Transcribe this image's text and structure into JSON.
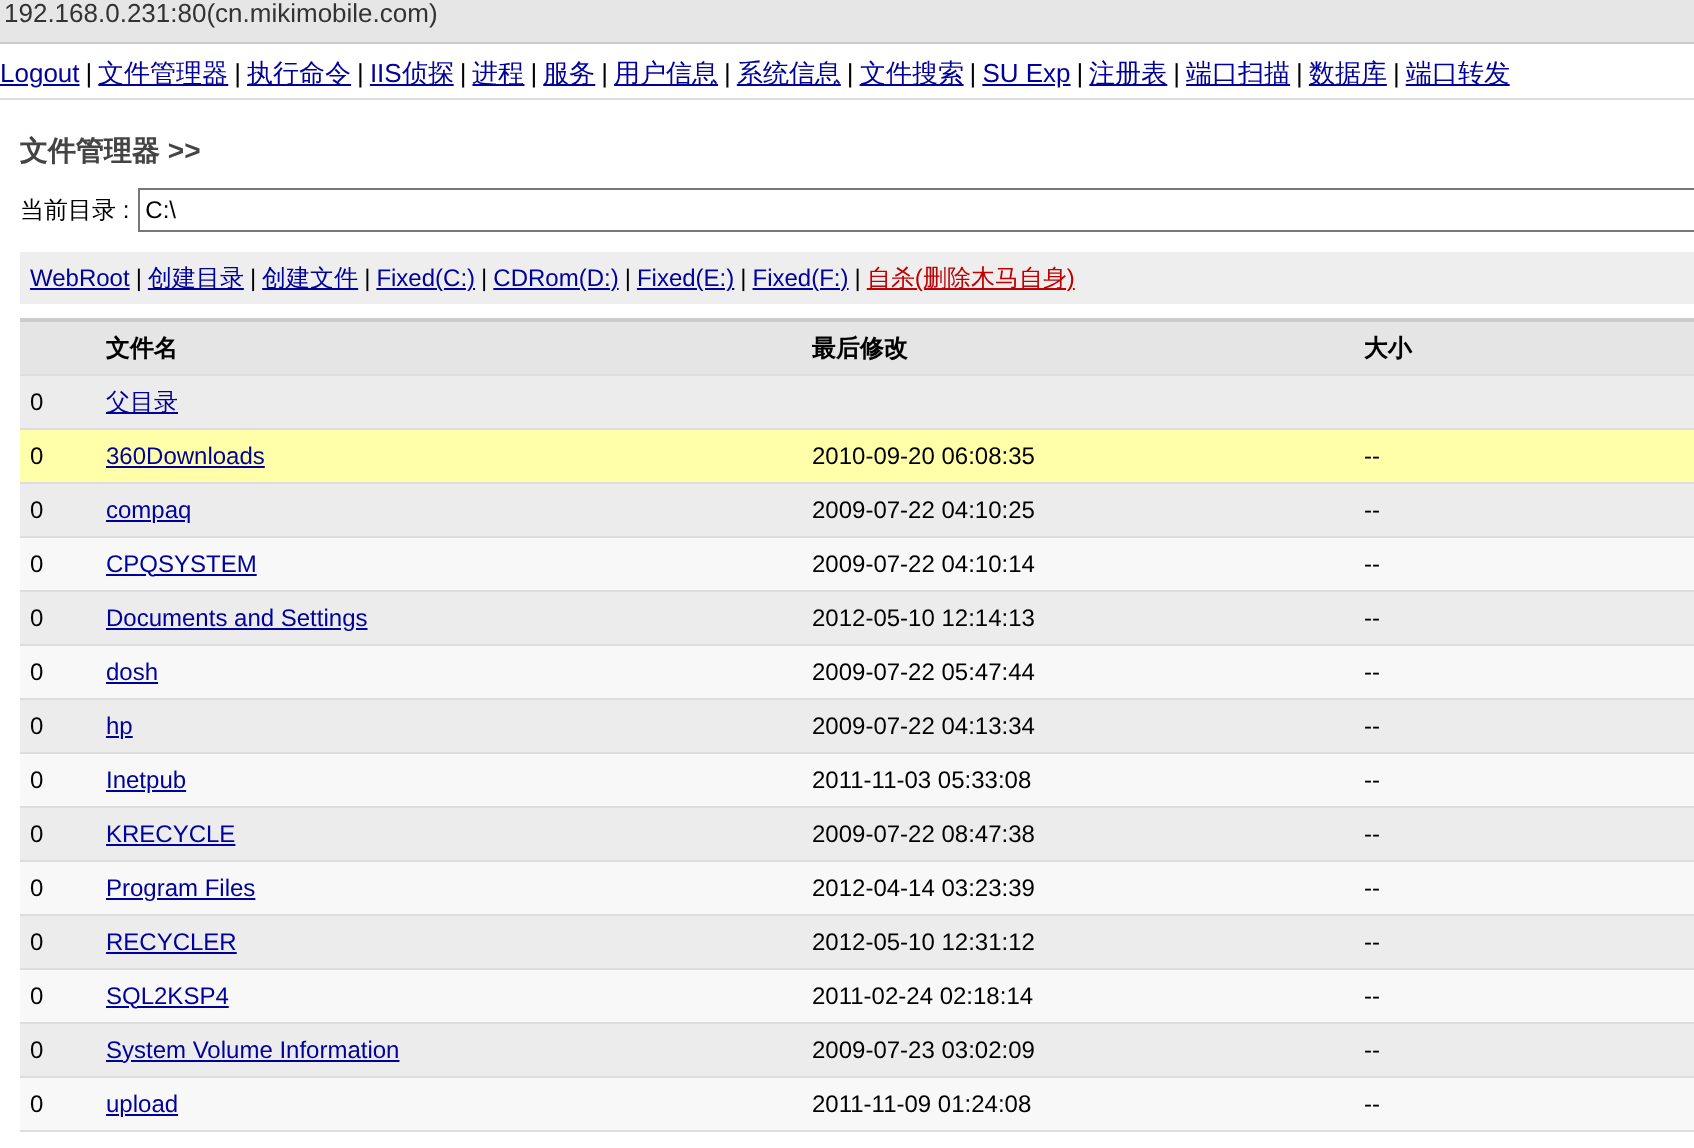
{
  "window": {
    "title": "192.168.0.231:80(cn.mikimobile.com)"
  },
  "separator": "|",
  "nav": [
    "Logout",
    "文件管理器",
    "执行命令",
    "IIS侦探",
    "进程",
    "服务",
    "用户信息",
    "系统信息",
    "文件搜索",
    "SU Exp",
    "注册表",
    "端口扫描",
    "数据库",
    "端口转发"
  ],
  "heading": "文件管理器 >>",
  "current_dir": {
    "label": "当前目录 :",
    "value": "C:\\"
  },
  "toolbar": [
    {
      "label": "WebRoot",
      "kind": "normal"
    },
    {
      "label": "创建目录",
      "kind": "normal"
    },
    {
      "label": "创建文件",
      "kind": "normal"
    },
    {
      "label": "Fixed(C:)",
      "kind": "normal"
    },
    {
      "label": "CDRom(D:)",
      "kind": "normal"
    },
    {
      "label": "Fixed(E:)",
      "kind": "normal"
    },
    {
      "label": "Fixed(F:)",
      "kind": "normal"
    },
    {
      "label": "自杀(删除木马自身)",
      "kind": "danger"
    }
  ],
  "table": {
    "columns": [
      "文件名",
      "最后修改",
      "大小"
    ],
    "rows": [
      {
        "index": "0",
        "name": "父目录",
        "highlighted": false
      },
      {
        "index": "0",
        "name": "360Downloads",
        "modified": "2010-09-20 06:08:35",
        "size": "--",
        "highlighted": true
      },
      {
        "index": "0",
        "name": "compaq",
        "modified": "2009-07-22 04:10:25",
        "size": "--",
        "highlighted": false
      },
      {
        "index": "0",
        "name": "CPQSYSTEM",
        "modified": "2009-07-22 04:10:14",
        "size": "--",
        "highlighted": false
      },
      {
        "index": "0",
        "name": "Documents and Settings",
        "modified": "2012-05-10 12:14:13",
        "size": "--",
        "highlighted": false
      },
      {
        "index": "0",
        "name": "dosh",
        "modified": "2009-07-22 05:47:44",
        "size": "--",
        "highlighted": false
      },
      {
        "index": "0",
        "name": "hp",
        "modified": "2009-07-22 04:13:34",
        "size": "--",
        "highlighted": false
      },
      {
        "index": "0",
        "name": "Inetpub",
        "modified": "2011-11-03 05:33:08",
        "size": "--",
        "highlighted": false
      },
      {
        "index": "0",
        "name": "KRECYCLE",
        "modified": "2009-07-22 08:47:38",
        "size": "--",
        "highlighted": false
      },
      {
        "index": "0",
        "name": "Program Files",
        "modified": "2012-04-14 03:23:39",
        "size": "--",
        "highlighted": false
      },
      {
        "index": "0",
        "name": "RECYCLER",
        "modified": "2012-05-10 12:31:12",
        "size": "--",
        "highlighted": false
      },
      {
        "index": "0",
        "name": "SQL2KSP4",
        "modified": "2011-02-24 02:18:14",
        "size": "--",
        "highlighted": false
      },
      {
        "index": "0",
        "name": "System Volume Information",
        "modified": "2009-07-23 03:02:09",
        "size": "--",
        "highlighted": false
      },
      {
        "index": "0",
        "name": "upload",
        "modified": "2011-11-09 01:24:08",
        "size": "--",
        "highlighted": false
      }
    ]
  }
}
